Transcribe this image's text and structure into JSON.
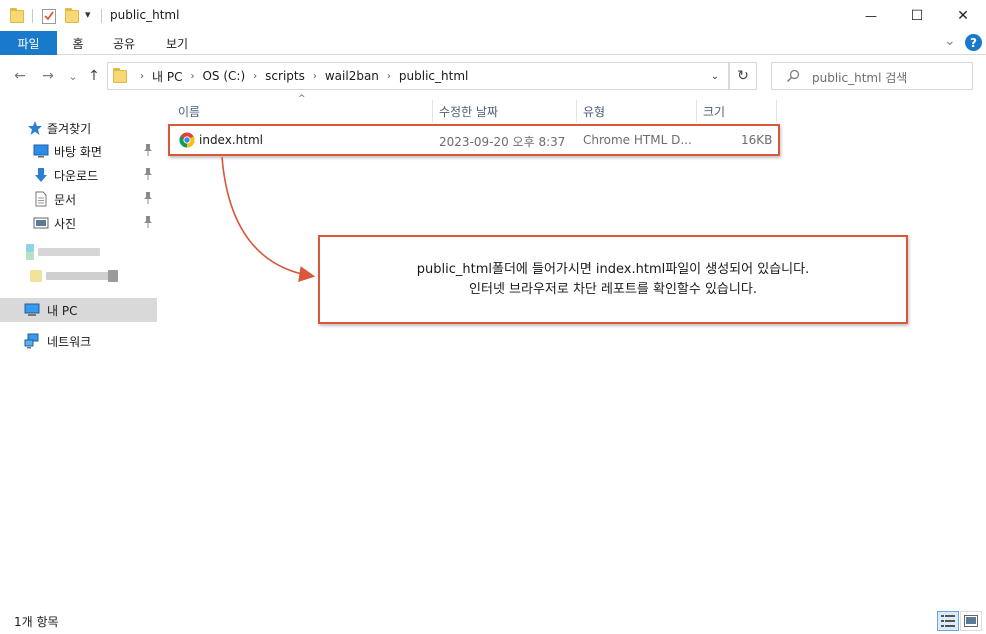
{
  "window": {
    "title": "public_html",
    "controls": {
      "minimize": "—",
      "maximize": "☐",
      "close": "✕"
    }
  },
  "quick_access_toolbar": {
    "dropdown_glyph": "▾"
  },
  "ribbon": {
    "tabs": [
      {
        "label": "파일",
        "active": true
      },
      {
        "label": "홈",
        "active": false
      },
      {
        "label": "공유",
        "active": false
      },
      {
        "label": "보기",
        "active": false
      }
    ],
    "expand_glyph": "⌄",
    "help_glyph": "?"
  },
  "navigation": {
    "back_glyph": "←",
    "forward_glyph": "→",
    "recent_glyph": "⌄",
    "up_glyph": "↑"
  },
  "address_bar": {
    "breadcrumbs": [
      "내 PC",
      "OS (C:)",
      "scripts",
      "wail2ban",
      "public_html"
    ],
    "separator": "›",
    "dropdown_glyph": "⌄",
    "refresh_glyph": "↻"
  },
  "search": {
    "placeholder": "public_html 검색"
  },
  "sidebar": {
    "quick_access": {
      "label": "즐겨찾기",
      "icon": "star-icon"
    },
    "items": [
      {
        "label": "바탕 화면",
        "icon": "desktop-icon",
        "pinned": true
      },
      {
        "label": "다운로드",
        "icon": "download-icon",
        "pinned": true
      },
      {
        "label": "문서",
        "icon": "document-icon",
        "pinned": true
      },
      {
        "label": "사진",
        "icon": "picture-icon",
        "pinned": true
      }
    ],
    "pin_glyph": "📌",
    "this_pc": {
      "label": "내 PC",
      "icon": "computer-icon",
      "selected": true
    },
    "network": {
      "label": "네트워크",
      "icon": "network-icon"
    }
  },
  "file_list": {
    "columns": {
      "name": "이름",
      "modified": "수정한 날짜",
      "type": "유형",
      "size": "크기"
    },
    "sort_glyph": "^",
    "files": [
      {
        "name": "index.html",
        "modified": "2023-09-20 오후 8:37",
        "type": "Chrome HTML D...",
        "size": "16KB",
        "icon": "chrome-icon"
      }
    ]
  },
  "annotation": {
    "line1": "public_html폴더에 들어가시면 index.html파일이 생성되어 있습니다.",
    "line2": "인터넷 브라우저로 차단 레포트를 확인할수 있습니다.",
    "accent_color": "#d9583b"
  },
  "status_bar": {
    "item_count": "1개 항목"
  },
  "colors": {
    "ribbon_active": "#1979ca",
    "selected_row": "#d9d9d9",
    "header_text": "#4c607a",
    "folder": "#f8d775"
  }
}
